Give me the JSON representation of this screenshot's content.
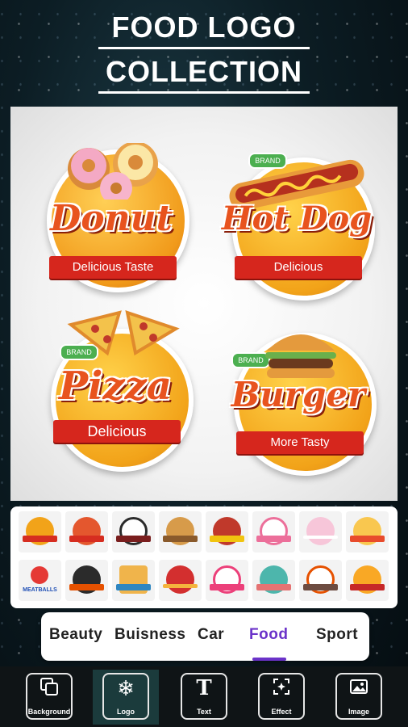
{
  "header": {
    "title_line1": "FOOD LOGO",
    "title_line2": "COLLECTION"
  },
  "preview_logos": [
    {
      "name": "Donut",
      "ribbon": "Delicious Taste"
    },
    {
      "name": "Hot Dog",
      "ribbon": "Delicious",
      "badge": "BRAND"
    },
    {
      "name": "Pizza",
      "ribbon": "Delicious",
      "badge": "BRAND"
    },
    {
      "name": "Burger",
      "ribbon": "More Tasty",
      "badge": "BRAND"
    }
  ],
  "thumbnails": {
    "row1_colors": [
      "#f2a319",
      "#e4572e",
      "#f5f5f5",
      "#8a5a2b",
      "#c0392b",
      "#ec6f9a",
      "#f7c6d9",
      "#e84b2c"
    ],
    "row2_colors": [
      "#e53935",
      "#2b2b2b",
      "#f0b44b",
      "#d32f2f",
      "#ec407a",
      "#4db6ac",
      "#e65100",
      "#f9a825"
    ],
    "row2_labels": {
      "first": "MEATBALLS"
    }
  },
  "categories": {
    "items": [
      "Beauty",
      "Buisness",
      "Car",
      "Food",
      "Sport"
    ],
    "active": "Food"
  },
  "toolbar": {
    "items": [
      "Background",
      "Logo",
      "Text",
      "Effect",
      "Image"
    ],
    "active": "Logo"
  },
  "colors": {
    "accent": "#6b33c9",
    "ribbon": "#d6261d",
    "badge": "#4caf50"
  }
}
